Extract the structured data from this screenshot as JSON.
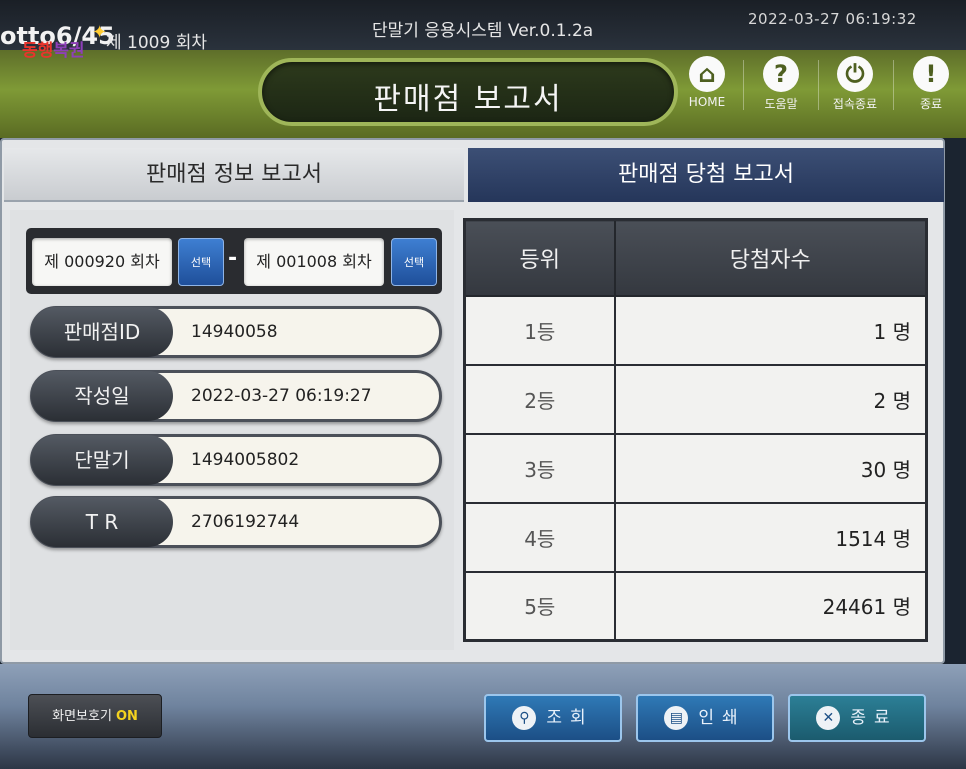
{
  "header": {
    "game_title": "otto6/45",
    "round": "제 1009 회차",
    "app_title": "단말기 응용시스템  Ver.0.1.2a",
    "datetime": "2022-03-27  06:19:32",
    "logo_part1": "동행",
    "logo_part2": "복권",
    "page_title": "판매점 보고서"
  },
  "nav": [
    {
      "label": "HOME",
      "icon": "home-icon"
    },
    {
      "label": "도움말",
      "icon": "help-icon"
    },
    {
      "label": "접속종료",
      "icon": "power-icon"
    },
    {
      "label": "종료",
      "icon": "exit-icon"
    }
  ],
  "tabs": {
    "info": "판매점 정보 보고서",
    "win": "판매점 당첨 보고서",
    "active": "win"
  },
  "range": {
    "from": "제 000920 회차",
    "to": "제 001008 회차",
    "select_label": "선택"
  },
  "info": [
    {
      "label": "판매점ID",
      "value": "14940058"
    },
    {
      "label": "작성일",
      "value": "2022-03-27  06:19:27"
    },
    {
      "label": "단말기",
      "value": "1494005802"
    },
    {
      "label": "T  R",
      "value": "2706192744"
    }
  ],
  "prize_table": {
    "headers": [
      "등위",
      "당첨자수"
    ],
    "rows": [
      {
        "rank": "1등",
        "count": "1 명"
      },
      {
        "rank": "2등",
        "count": "2 명"
      },
      {
        "rank": "3등",
        "count": "30 명"
      },
      {
        "rank": "4등",
        "count": "1514 명"
      },
      {
        "rank": "5등",
        "count": "24461 명"
      }
    ]
  },
  "footer": {
    "screensaver_label": "화면보호기",
    "screensaver_state": "ON",
    "query_label": "조회",
    "print_label": "인쇄",
    "exit_label": "종료"
  },
  "colors": {
    "banner_green": "#7f9a36",
    "active_tab": "#25365a",
    "button_blue": "#1f4f9a"
  }
}
